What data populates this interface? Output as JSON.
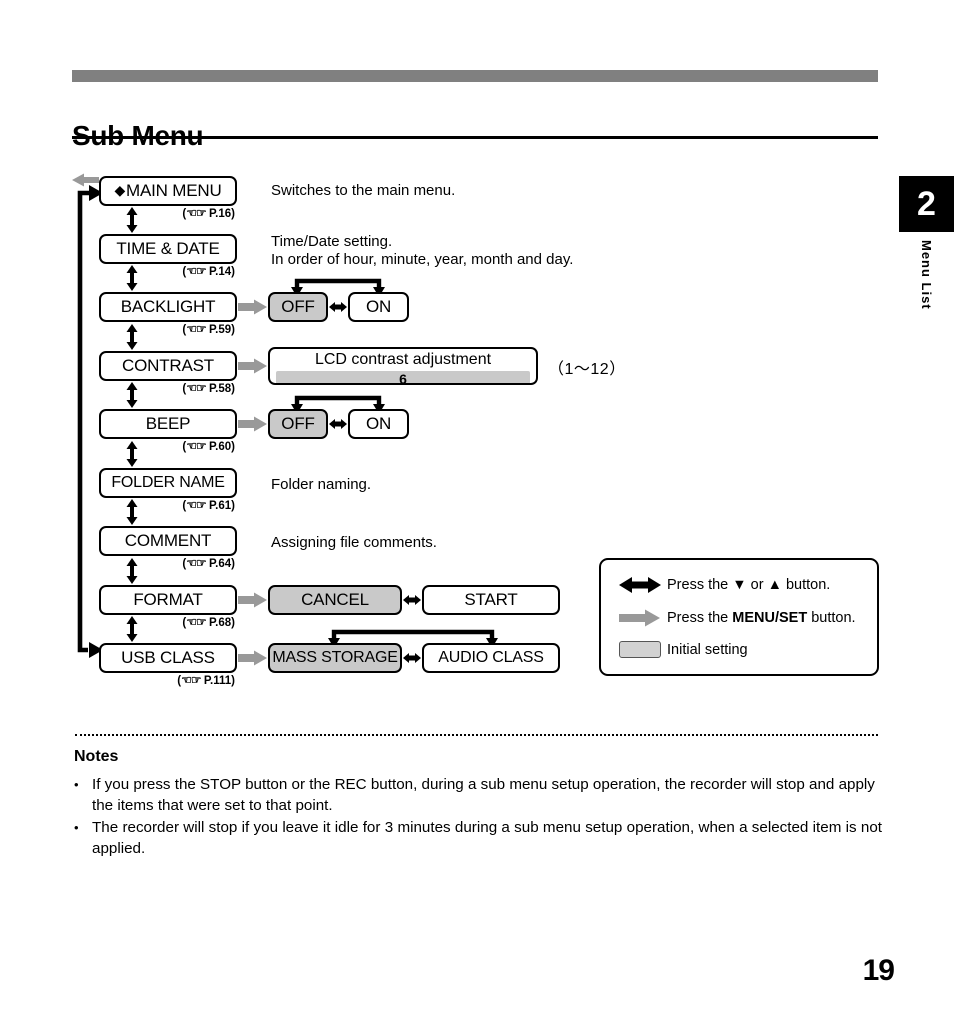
{
  "page": {
    "title": "Sub Menu",
    "folio": "19",
    "chapter_number": "2",
    "chapter_label": "Menu List"
  },
  "menu_items": [
    {
      "label": "MAIN MENU",
      "diamond": "◆",
      "page_ref": "P.16",
      "ref_prefix": "(",
      "ref_suffix": ")"
    },
    {
      "label": "TIME & DATE",
      "diamond": "",
      "page_ref": "P.14",
      "ref_prefix": "(",
      "ref_suffix": ")"
    },
    {
      "label": "BACKLIGHT",
      "diamond": "",
      "page_ref": "P.59",
      "ref_prefix": "(",
      "ref_suffix": ")"
    },
    {
      "label": "CONTRAST",
      "diamond": "",
      "page_ref": "P.58",
      "ref_prefix": "(",
      "ref_suffix": ")"
    },
    {
      "label": "BEEP",
      "diamond": "",
      "page_ref": "P.60",
      "ref_prefix": "(",
      "ref_suffix": ")"
    },
    {
      "label": "FOLDER NAME",
      "diamond": "",
      "page_ref": "P.61",
      "ref_prefix": "(",
      "ref_suffix": ")"
    },
    {
      "label": "COMMENT",
      "diamond": "",
      "page_ref": "P.64",
      "ref_prefix": "(",
      "ref_suffix": ")"
    },
    {
      "label": "FORMAT",
      "diamond": "",
      "page_ref": "P.68",
      "ref_prefix": "(",
      "ref_suffix": ")"
    },
    {
      "label": "USB CLASS",
      "diamond": "",
      "page_ref": "P.111",
      "ref_prefix": "(",
      "ref_suffix": ")"
    }
  ],
  "descriptions": {
    "main_menu": "Switches to the main menu.",
    "time_date_line1": "Time/Date setting.",
    "time_date_line2": "In order of hour, minute, year, month and day.",
    "folder_name": "Folder naming.",
    "comment": "Assigning file comments."
  },
  "options": {
    "backlight": {
      "initial": "OFF",
      "alternate": "ON"
    },
    "beep": {
      "initial": "OFF",
      "alternate": "ON"
    },
    "format": {
      "initial": "CANCEL",
      "alternate": "START"
    },
    "usb_class": {
      "initial": "MASS STORAGE",
      "alternate": "AUDIO CLASS"
    }
  },
  "contrast": {
    "label": "LCD contrast adjustment",
    "value": "6",
    "range_note": "（1～12）"
  },
  "legend": {
    "double_arrow_text_a": "Press the ▼ or ▲ button.",
    "menu_set_prefix": "Press the ",
    "menu_set_bold": "MENU/SET",
    "menu_set_suffix": " button.",
    "initial_setting": "Initial setting"
  },
  "notes": {
    "heading": "Notes",
    "items": [
      "If you press the STOP button or the REC button, during a sub menu setup operation, the recorder will stop and apply the items that were set to that point.",
      "The recorder will stop if you leave it idle for 3 minutes during a sub menu setup operation, when a selected item is not applied."
    ],
    "bullet": "•"
  },
  "colors": {
    "header_bar": "#808080",
    "initial_fill": "#c9c9c9",
    "gray_arrow": "#999999",
    "black": "#000000"
  }
}
